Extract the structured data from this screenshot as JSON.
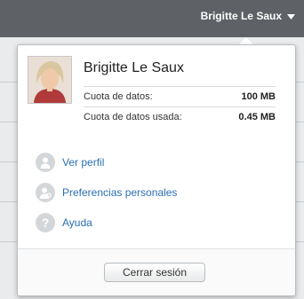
{
  "header": {
    "user_label": "Brigitte Le Saux",
    "dropdown_icon": "chevron-down-icon"
  },
  "account_menu": {
    "name": "Brigitte Le Saux",
    "avatar_icon": "user-photo",
    "quota": [
      {
        "label": "Cuota de datos:",
        "value": "100 MB"
      },
      {
        "label": "Cuota de datos usada:",
        "value": "0.45 MB"
      }
    ],
    "items": [
      {
        "label": "Ver perfil",
        "icon": "user-icon"
      },
      {
        "label": "Preferencias personales",
        "icon": "settings-user-icon"
      },
      {
        "label": "Ayuda",
        "icon": "help-icon"
      }
    ],
    "logout_label": "Cerrar sesión"
  },
  "colors": {
    "topbar": "#5e6266",
    "link": "#2a6fb3"
  }
}
